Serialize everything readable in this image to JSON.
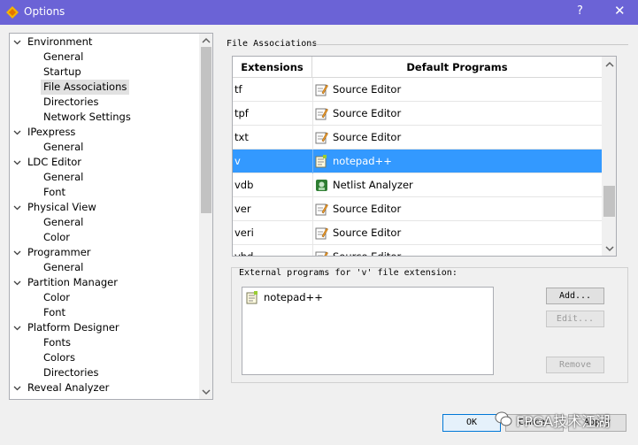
{
  "window": {
    "title": "Options",
    "help_label": "?",
    "close_label": "✕",
    "accent": "#6b63d6"
  },
  "tree": {
    "items": [
      {
        "label": "Environment",
        "level": 0,
        "expanded": true
      },
      {
        "label": "General",
        "level": 1
      },
      {
        "label": "Startup",
        "level": 1
      },
      {
        "label": "File Associations",
        "level": 1,
        "selected": true
      },
      {
        "label": "Directories",
        "level": 1
      },
      {
        "label": "Network Settings",
        "level": 1
      },
      {
        "label": "IPexpress",
        "level": 0,
        "expanded": true
      },
      {
        "label": "General",
        "level": 1
      },
      {
        "label": "LDC Editor",
        "level": 0,
        "expanded": true
      },
      {
        "label": "General",
        "level": 1
      },
      {
        "label": "Font",
        "level": 1
      },
      {
        "label": "Physical View",
        "level": 0,
        "expanded": true
      },
      {
        "label": "General",
        "level": 1
      },
      {
        "label": "Color",
        "level": 1
      },
      {
        "label": "Programmer",
        "level": 0,
        "expanded": true
      },
      {
        "label": "General",
        "level": 1
      },
      {
        "label": "Partition Manager",
        "level": 0,
        "expanded": true
      },
      {
        "label": "Color",
        "level": 1
      },
      {
        "label": "Font",
        "level": 1
      },
      {
        "label": "Platform Designer",
        "level": 0,
        "expanded": true
      },
      {
        "label": "Fonts",
        "level": 1
      },
      {
        "label": "Colors",
        "level": 1
      },
      {
        "label": "Directories",
        "level": 1
      },
      {
        "label": "Reveal Analyzer",
        "level": 0,
        "expanded": true
      }
    ]
  },
  "file_associations": {
    "group_label": "File Associations",
    "columns": {
      "extensions": "Extensions",
      "default_programs": "Default Programs"
    },
    "rows": [
      {
        "ext": "tf",
        "program": "Source Editor",
        "icon": "source-editor-icon"
      },
      {
        "ext": "tpf",
        "program": "Source Editor",
        "icon": "source-editor-icon"
      },
      {
        "ext": "txt",
        "program": "Source Editor",
        "icon": "source-editor-icon"
      },
      {
        "ext": "v",
        "program": "notepad++",
        "icon": "notepad-icon",
        "selected": true
      },
      {
        "ext": "vdb",
        "program": "Netlist Analyzer",
        "icon": "netlist-analyzer-icon"
      },
      {
        "ext": "ver",
        "program": "Source Editor",
        "icon": "source-editor-icon"
      },
      {
        "ext": "veri",
        "program": "Source Editor",
        "icon": "source-editor-icon"
      },
      {
        "ext": "vhd",
        "program": "Source Editor",
        "icon": "source-editor-icon"
      }
    ],
    "selection_color": "#3399ff"
  },
  "external_programs": {
    "group_label": "External programs for 'v' file extension:",
    "items": [
      {
        "label": "notepad++",
        "icon": "notepad-icon"
      }
    ],
    "add_label": "Add...",
    "edit_label": "Edit...",
    "remove_label": "Remove"
  },
  "footer": {
    "ok_label": "OK",
    "cancel_label": "Cancel",
    "apply_label": "Apply"
  },
  "watermark": {
    "text": "FPGA技术江湖"
  }
}
